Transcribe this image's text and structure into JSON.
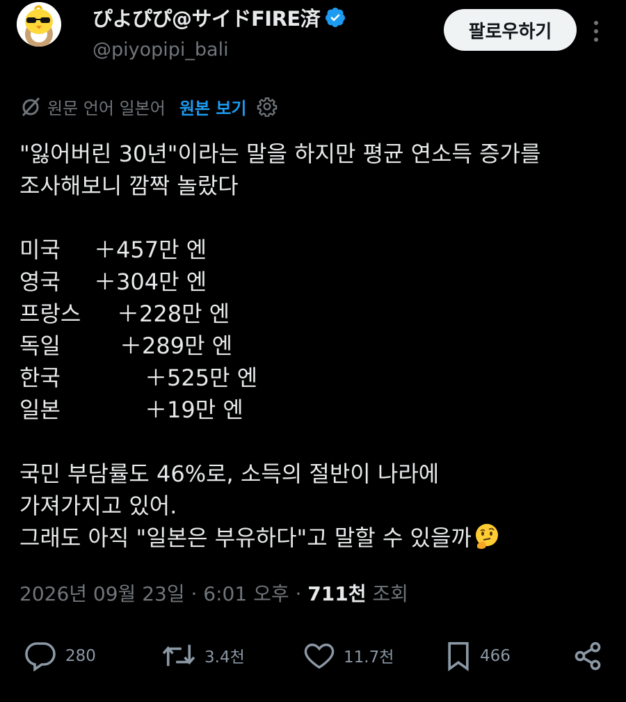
{
  "author": {
    "display_name": "ぴよぴぴ@サイドFIRE済",
    "handle": "@piyopipi_bali",
    "avatar_icon": "yellow-chick-avatar-icon",
    "verified_icon": "verified-badge-icon",
    "verified_color": "#1d9bf0"
  },
  "follow_label": "팔로우하기",
  "more_icon": "more-vertical-icon",
  "translation": {
    "label": "원문 언어 일본어",
    "show_original": "원본 보기",
    "icon": "translate-icon",
    "settings_icon": "gear-icon"
  },
  "tweet": {
    "line1": "\"잃어버린 30년\"이라는 말을 하지만 평균 연소득 증가를",
    "line2": "조사해보니 깜짝 놀랐다",
    "countries": [
      {
        "name": "미국",
        "amount": "＋457만 엔"
      },
      {
        "name": "영국",
        "amount": "＋304만 엔"
      },
      {
        "name": "프랑스",
        "amount": "＋228만 엔"
      },
      {
        "name": "독일",
        "amount": "＋289만 엔"
      },
      {
        "name": "한국",
        "amount": "＋525만 엔"
      },
      {
        "name": "일본",
        "amount": "＋19만 엔"
      }
    ],
    "line3": "국민 부담률도 46%로, 소득의 절반이 나라에",
    "line4": "가져가지고 있어.",
    "line5": "그래도 아직 \"일본은 부유하다\"고 말할 수 있을까",
    "emoji": "thinking-face-emoji"
  },
  "meta": {
    "date": "2026년 09월 23일 · 6:01 오후 · ",
    "views_count": "711천",
    "views_label": " 조회"
  },
  "actions": {
    "replies": "280",
    "retweets": "3.4천",
    "likes": "11.7천",
    "bookmarks": "466"
  },
  "colors": {
    "background": "#000000",
    "text": "#e7e9ea",
    "secondary": "#71767b",
    "accent": "#1d9bf0"
  }
}
